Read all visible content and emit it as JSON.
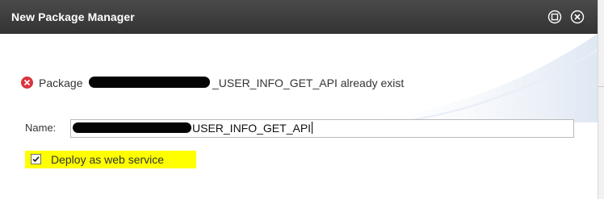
{
  "window": {
    "title": "New Package Manager",
    "buttons": [
      "maximize-icon",
      "close-icon"
    ]
  },
  "message": {
    "icon": "error-icon",
    "prefix": "Package",
    "suffix": "_USER_INFO_GET_API already exist"
  },
  "name_field": {
    "label": "Name:",
    "value_visible": "USER_INFO_GET_API"
  },
  "deploy_option": {
    "label": "Deploy as web service",
    "checked": true
  },
  "colors": {
    "titlebar": "#3a3a3a",
    "highlight": "#ffff00",
    "error": "#d9333f"
  }
}
